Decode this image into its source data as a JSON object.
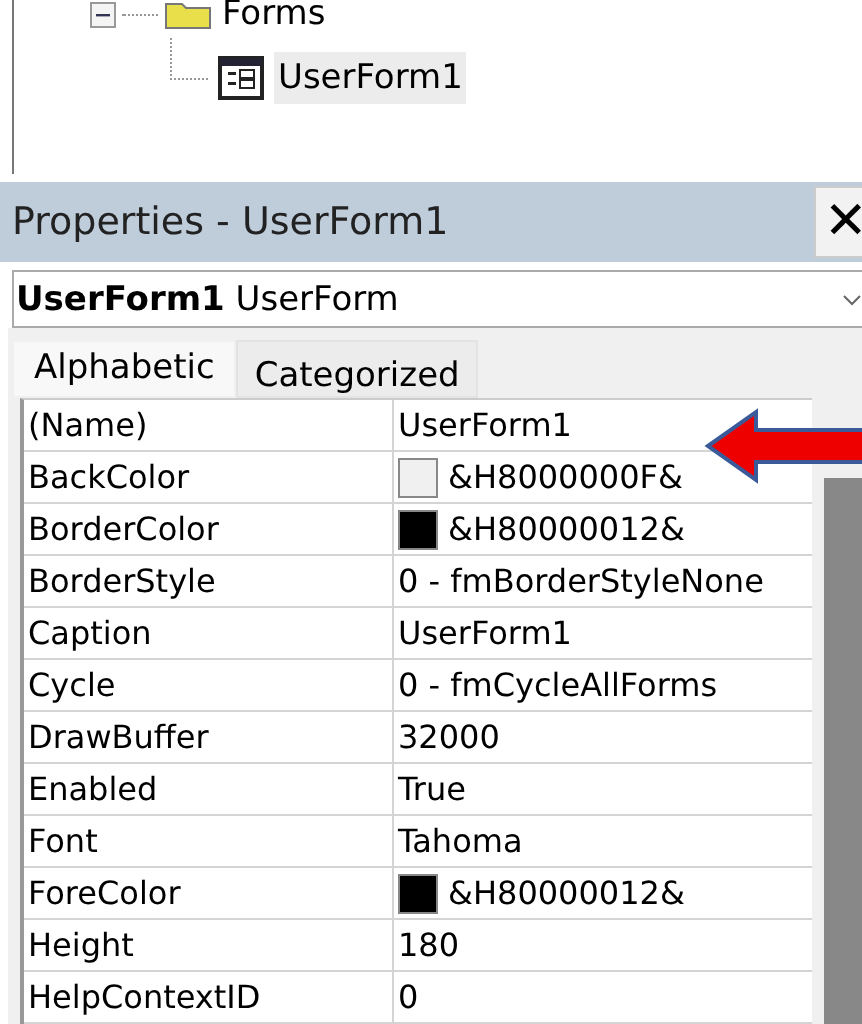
{
  "tree": {
    "folder": {
      "label": "Forms",
      "expanded": true
    },
    "item": {
      "label": "UserForm1",
      "selected": true
    }
  },
  "properties": {
    "title": "Properties - UserForm1",
    "close": "✕",
    "object": {
      "name": "UserForm1",
      "type": "UserForm"
    },
    "tabs": [
      {
        "label": "Alphabetic",
        "selected": true
      },
      {
        "label": "Categorized",
        "selected": false
      }
    ],
    "rows": [
      {
        "name": "(Name)",
        "value": "UserForm1",
        "kind": "text"
      },
      {
        "name": "BackColor",
        "value": "&H8000000F&",
        "kind": "color",
        "color": "#f0f0f0"
      },
      {
        "name": "BorderColor",
        "value": "&H80000012&",
        "kind": "color",
        "color": "#000000"
      },
      {
        "name": "BorderStyle",
        "value": "0 - fmBorderStyleNone",
        "kind": "text"
      },
      {
        "name": "Caption",
        "value": "UserForm1",
        "kind": "text"
      },
      {
        "name": "Cycle",
        "value": "0 - fmCycleAllForms",
        "kind": "text"
      },
      {
        "name": "DrawBuffer",
        "value": "32000",
        "kind": "text"
      },
      {
        "name": "Enabled",
        "value": "True",
        "kind": "text"
      },
      {
        "name": "Font",
        "value": "Tahoma",
        "kind": "text"
      },
      {
        "name": "ForeColor",
        "value": "&H80000012&",
        "kind": "color",
        "color": "#000000"
      },
      {
        "name": "Height",
        "value": "180",
        "kind": "text"
      },
      {
        "name": "HelpContextID",
        "value": "0",
        "kind": "text"
      }
    ]
  }
}
